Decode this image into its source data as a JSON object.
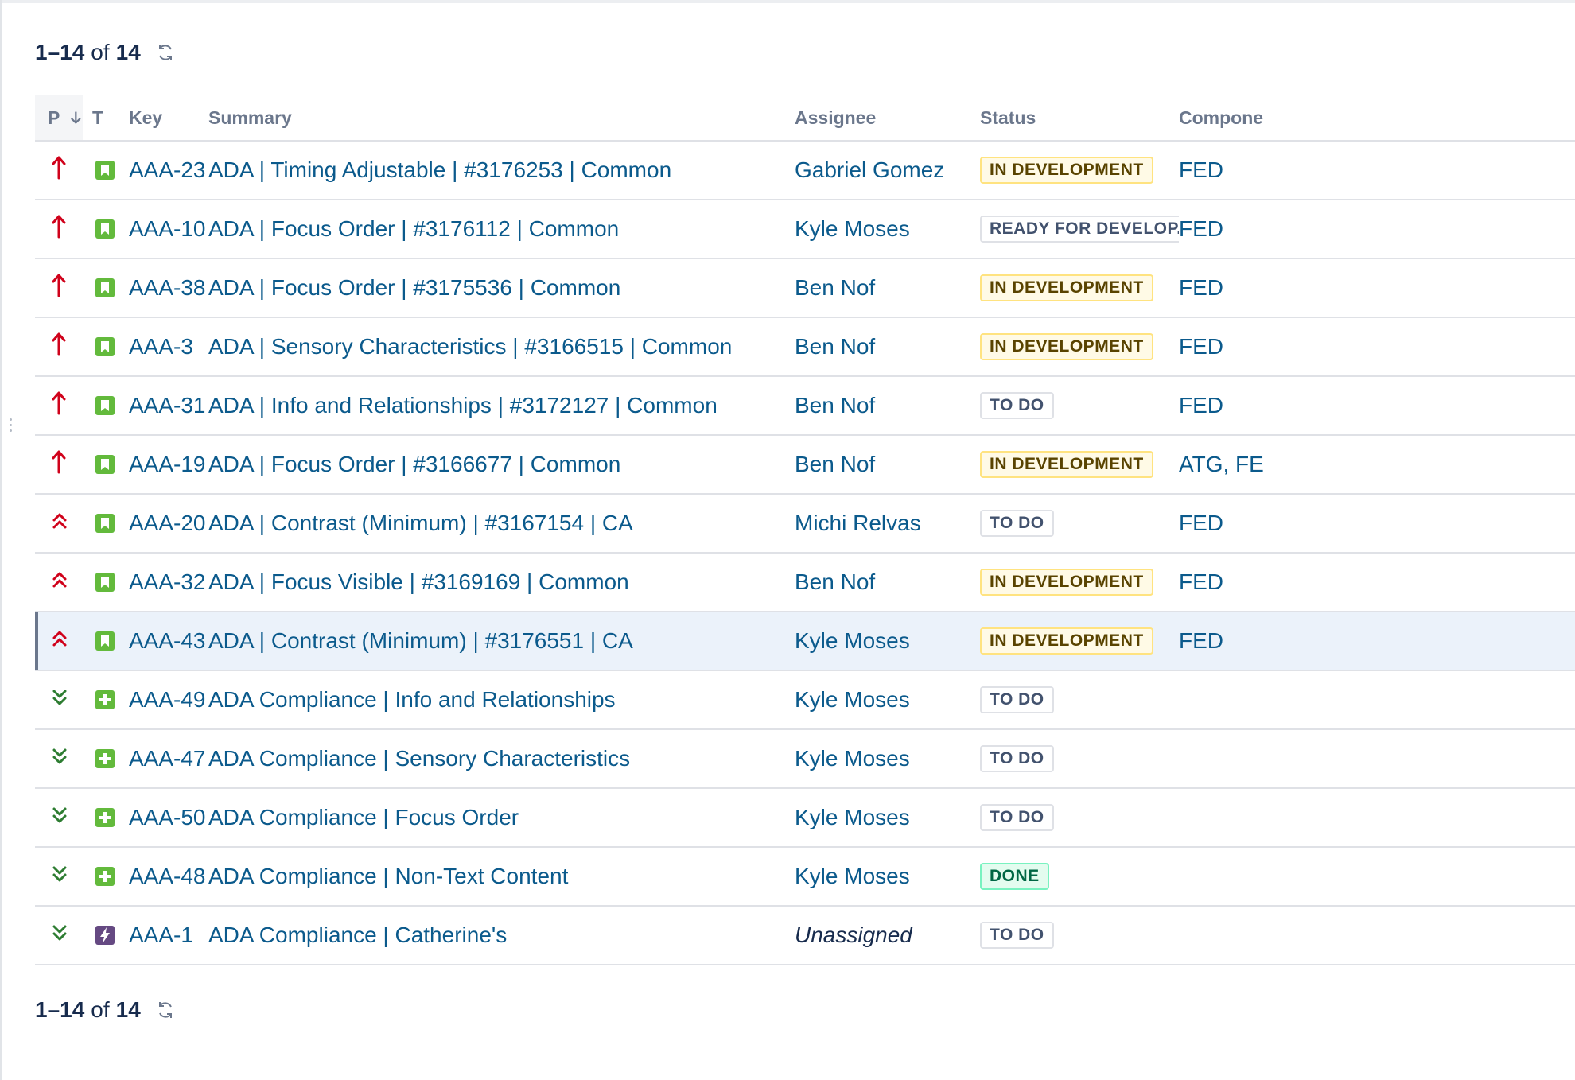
{
  "pagination_top": {
    "range": "1–14",
    "of_label": "of",
    "total": "14"
  },
  "pagination_bottom": {
    "range": "1–14",
    "of_label": "of",
    "total": "14"
  },
  "columns": {
    "priority": "P",
    "type": "T",
    "key": "Key",
    "summary": "Summary",
    "assignee": "Assignee",
    "status": "Status",
    "components": "Compone"
  },
  "colors": {
    "link": "#0b5a8c",
    "priority_high": "#d0021b",
    "priority_low": "#2e7d32",
    "story_green": "#63ba3c",
    "epic_purple": "#654982"
  },
  "issues": [
    {
      "priority": "highest",
      "type": "story",
      "key": "AAA-23",
      "summary": "ADA | Timing Adjustable | #3176253 | Common",
      "assignee": "Gabriel Gomez",
      "status": "IN DEVELOPMENT",
      "status_color": "yellow",
      "components": "FED"
    },
    {
      "priority": "highest",
      "type": "story",
      "key": "AAA-10",
      "summary": "ADA | Focus Order | #3176112 | Common",
      "assignee": "Kyle Moses",
      "status": "READY FOR DEVELOP...",
      "status_color": "gray",
      "components": "FED"
    },
    {
      "priority": "highest",
      "type": "story",
      "key": "AAA-38",
      "summary": "ADA | Focus Order | #3175536 | Common",
      "assignee": "Ben Nof",
      "status": "IN DEVELOPMENT",
      "status_color": "yellow",
      "components": "FED"
    },
    {
      "priority": "highest",
      "type": "story",
      "key": "AAA-3",
      "summary": "ADA | Sensory Characteristics | #3166515 | Common",
      "assignee": "Ben Nof",
      "status": "IN DEVELOPMENT",
      "status_color": "yellow",
      "components": "FED"
    },
    {
      "priority": "highest",
      "type": "story",
      "key": "AAA-31",
      "summary": "ADA | Info and Relationships | #3172127 | Common",
      "assignee": "Ben Nof",
      "status": "TO DO",
      "status_color": "gray",
      "components": "FED"
    },
    {
      "priority": "highest",
      "type": "story",
      "key": "AAA-19",
      "summary": "ADA | Focus Order | #3166677 | Common",
      "assignee": "Ben Nof",
      "status": "IN DEVELOPMENT",
      "status_color": "yellow",
      "components": "ATG, FE"
    },
    {
      "priority": "high",
      "type": "story",
      "key": "AAA-20",
      "summary": "ADA | Contrast (Minimum) | #3167154 | CA",
      "assignee": "Michi Relvas",
      "status": "TO DO",
      "status_color": "gray",
      "components": "FED"
    },
    {
      "priority": "high",
      "type": "story",
      "key": "AAA-32",
      "summary": "ADA | Focus Visible | #3169169 | Common",
      "assignee": "Ben Nof",
      "status": "IN DEVELOPMENT",
      "status_color": "yellow",
      "components": "FED"
    },
    {
      "priority": "high",
      "type": "story",
      "key": "AAA-43",
      "summary": "ADA | Contrast (Minimum) | #3176551 | CA",
      "assignee": "Kyle Moses",
      "status": "IN DEVELOPMENT",
      "status_color": "yellow",
      "components": "FED",
      "selected": true
    },
    {
      "priority": "low",
      "type": "new-feature",
      "key": "AAA-49",
      "summary": "ADA Compliance | Info and Relationships",
      "assignee": "Kyle Moses",
      "status": "TO DO",
      "status_color": "gray",
      "components": ""
    },
    {
      "priority": "low",
      "type": "new-feature",
      "key": "AAA-47",
      "summary": "ADA Compliance | Sensory Characteristics",
      "assignee": "Kyle Moses",
      "status": "TO DO",
      "status_color": "gray",
      "components": ""
    },
    {
      "priority": "low",
      "type": "new-feature",
      "key": "AAA-50",
      "summary": "ADA Compliance | Focus Order",
      "assignee": "Kyle Moses",
      "status": "TO DO",
      "status_color": "gray",
      "components": ""
    },
    {
      "priority": "low",
      "type": "new-feature",
      "key": "AAA-48",
      "summary": "ADA Compliance | Non-Text Content",
      "assignee": "Kyle Moses",
      "status": "DONE",
      "status_color": "green",
      "components": ""
    },
    {
      "priority": "low",
      "type": "epic",
      "key": "AAA-1",
      "summary": "ADA Compliance | Catherine's",
      "assignee": "Unassigned",
      "assignee_unassigned": true,
      "status": "TO DO",
      "status_color": "gray",
      "components": ""
    }
  ]
}
